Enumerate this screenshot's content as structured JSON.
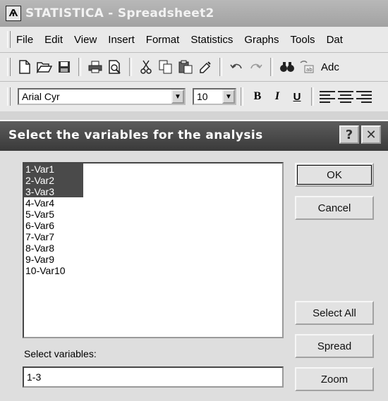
{
  "app": {
    "logo_glyph": "Ѧ",
    "title": "STATISTICA - Spreadsheet2"
  },
  "menu": [
    "File",
    "Edit",
    "View",
    "Insert",
    "Format",
    "Statistics",
    "Graphs",
    "Tools",
    "Dat"
  ],
  "toolbar": {
    "icons": [
      "new-document-icon",
      "open-folder-icon",
      "save-icon",
      "print-icon",
      "print-preview-icon",
      "cut-icon",
      "copy-icon",
      "paste-icon",
      "format-painter-icon",
      "undo-icon",
      "redo-icon",
      "find-icon",
      "replace-icon"
    ],
    "trailing_text": "Adc"
  },
  "format_bar": {
    "font_name": "Arial Cyr",
    "font_size": "10",
    "bold": "B",
    "italic": "I",
    "underline": "U"
  },
  "dialog": {
    "title": "Select the variables for the analysis",
    "help": "?",
    "close": "✕",
    "variables": [
      {
        "label": "1-Var1",
        "selected": true
      },
      {
        "label": "2-Var2",
        "selected": true
      },
      {
        "label": "3-Var3",
        "selected": true
      },
      {
        "label": "4-Var4",
        "selected": false
      },
      {
        "label": "5-Var5",
        "selected": false
      },
      {
        "label": "6-Var6",
        "selected": false
      },
      {
        "label": "7-Var7",
        "selected": false
      },
      {
        "label": "8-Var8",
        "selected": false
      },
      {
        "label": "9-Var9",
        "selected": false
      },
      {
        "label": "10-Var10",
        "selected": false
      }
    ],
    "buttons": {
      "ok": "OK",
      "cancel": "Cancel",
      "select_all": "Select All",
      "spread": "Spread",
      "zoom": "Zoom"
    },
    "select_label": "Select variables:",
    "select_value": "1-3"
  },
  "colors": {
    "dialog_titlebar": "#444444",
    "selection": "#4a4a4a"
  }
}
